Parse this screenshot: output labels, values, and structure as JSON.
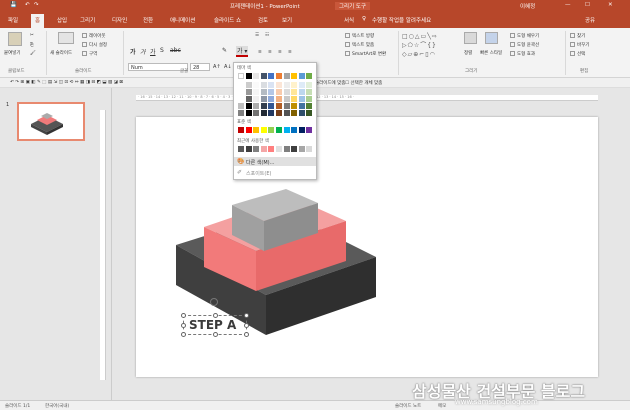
{
  "window": {
    "doc_title": "프레젠테이션1 - PowerPoint",
    "tools_label": "그리기 도구",
    "user": "이혜정"
  },
  "tabs": [
    "파일",
    "홈",
    "삽입",
    "그리기",
    "디자인",
    "전환",
    "애니메이션",
    "슬라이드 쇼",
    "검토",
    "보기",
    "서식"
  ],
  "tell_me": "수행할 작업을 알려주세요",
  "share": "공유",
  "ribbon": {
    "clipboard": {
      "label": "클립보드",
      "paste": "붙여넣기"
    },
    "slides": {
      "label": "슬라이드",
      "new_slide": "새 슬라이드",
      "layout": "레이아웃",
      "reset": "다시 설정",
      "section": "구역"
    },
    "font": {
      "label": "글꼴",
      "name": "Num",
      "size": "28"
    },
    "paragraph": {
      "text_direction": "텍스트 방향",
      "align_text": "텍스트 맞춤",
      "smartart": "SmartArt로 변환"
    },
    "drawing": {
      "label": "그리기",
      "arrange": "정렬",
      "quick_styles": "빠른 스타일",
      "shape_fill": "도형 채우기",
      "shape_outline": "도형 윤곽선",
      "shape_effects": "도형 효과"
    },
    "editing": {
      "label": "편집",
      "find": "찾기",
      "replace": "바꾸기",
      "select": "선택"
    }
  },
  "qat": {
    "fit_slide": "슬라이드에 맞춤",
    "select_objects": "선택한 개체 맞춤"
  },
  "dropdown": {
    "theme_label": "테마 색",
    "standard_label": "표준 색",
    "recent_label": "최근에 사용한 색",
    "more_colors": "다른 색(M)...",
    "eyedropper": "스포이트(E)",
    "theme_top": [
      "#ffffff",
      "#000000",
      "#e7e6e6",
      "#44546a",
      "#4472c4",
      "#ed7d31",
      "#a5a5a5",
      "#ffc000",
      "#5b9bd5",
      "#70ad47"
    ],
    "standard": [
      "#c00000",
      "#ff0000",
      "#ffc000",
      "#ffff00",
      "#92d050",
      "#00b050",
      "#00b0f0",
      "#0070c0",
      "#002060",
      "#7030a0"
    ],
    "recent": [
      "#595959",
      "#404040",
      "#808080",
      "#f4a6a6",
      "#ff7f7f",
      "#e0e0e0",
      "#7f7f7f",
      "#3f3f3f",
      "#a6a6a6",
      "#d9d9d9"
    ]
  },
  "slide_panel": {
    "slide_number": "1"
  },
  "slide": {
    "text_box": "STEP A"
  },
  "status": {
    "slide_info": "슬라이드 1/1",
    "language": "한국어(국내)",
    "notes": "슬라이드 노트",
    "comments": "메모"
  },
  "watermark": {
    "line1": "삼성물산 건설부문 블로그",
    "line2": "www.samsungblog.com"
  }
}
